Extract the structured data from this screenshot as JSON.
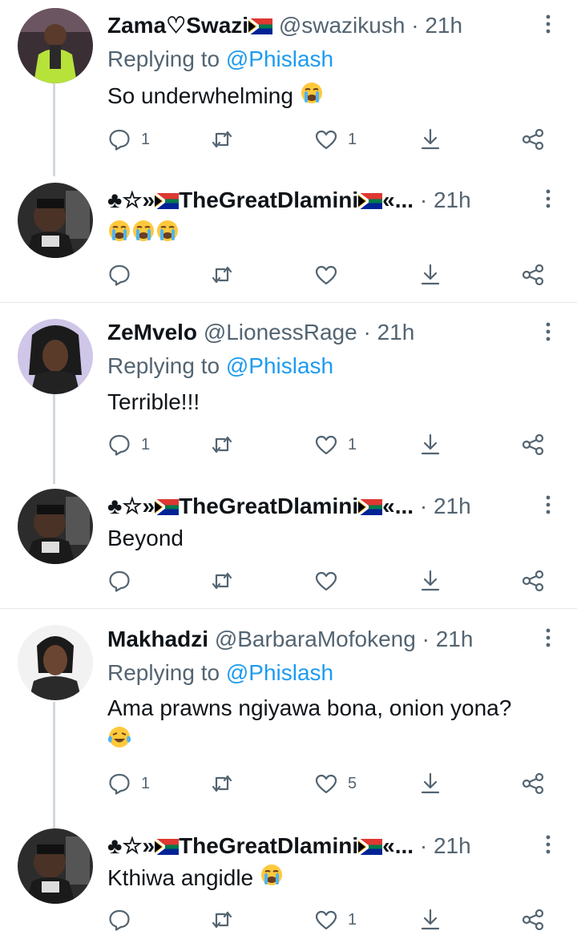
{
  "thread": [
    {
      "name": "Zama♡Swazi",
      "flag_after_name": true,
      "handle": "@swazikush",
      "time": "21h",
      "replying_prefix": "Replying to",
      "replying_to": "@Phislash",
      "text": "So underwhelming",
      "emojis": 1,
      "replies": "1",
      "likes": "1",
      "avatar": "woman-green-jacket"
    },
    {
      "name_prefix": "♣☆»",
      "name": "TheGreatDlamini",
      "name_suffix": "«...",
      "time": "21h",
      "text": "",
      "emojis": 3,
      "replies": "",
      "likes": "",
      "avatar": "man-tattoo"
    },
    {
      "name": "ZeMvelo",
      "handle": "@LionessRage",
      "time": "21h",
      "replying_prefix": "Replying to",
      "replying_to": "@Phislash",
      "text": "Terrible!!!",
      "emojis": 0,
      "replies": "1",
      "likes": "1",
      "avatar": "woman-braids"
    },
    {
      "name_prefix": "♣☆»",
      "name": "TheGreatDlamini",
      "name_suffix": "«...",
      "time": "21h",
      "text": "Beyond",
      "emojis": 0,
      "replies": "",
      "likes": "",
      "avatar": "man-tattoo"
    },
    {
      "name": "Makhadzi",
      "handle": "@BarbaraMofokeng",
      "time": "21h",
      "replying_prefix": "Replying to",
      "replying_to": "@Phislash",
      "text": "Ama prawns ngiyawa bona, onion yona?",
      "emojis": 1,
      "replies": "1",
      "likes": "5",
      "avatar": "woman-dark-hair"
    },
    {
      "name_prefix": "♣☆»",
      "name": "TheGreatDlamini",
      "name_suffix": "«...",
      "time": "21h",
      "text": "Kthiwa angidle",
      "emojis": 1,
      "replies": "",
      "likes": "1",
      "avatar": "man-tattoo"
    }
  ],
  "colors": {
    "text": "#0f1419",
    "secondary": "#536471",
    "accent": "#1d9bf0",
    "divider": "#e3e7ea",
    "thread_line": "#cfd9de"
  },
  "icons": [
    "reply-icon",
    "retweet-icon",
    "like-icon",
    "share-icon",
    "share-network-icon",
    "more-icon"
  ]
}
